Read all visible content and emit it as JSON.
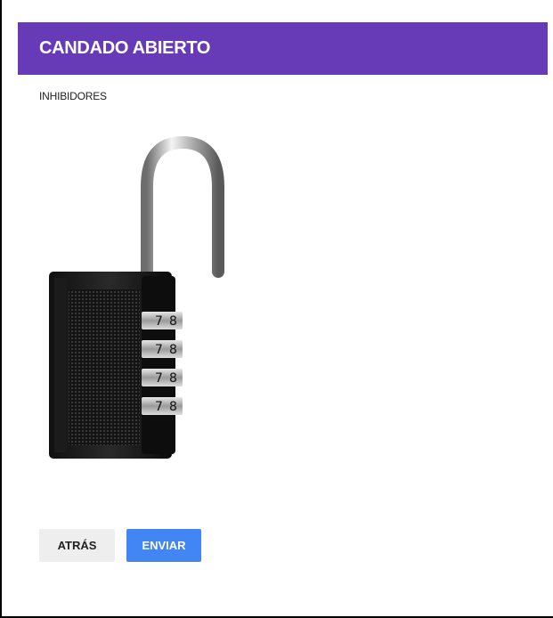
{
  "header": {
    "title": "CANDADO ABIERTO"
  },
  "content": {
    "subtitle": "INHIBIDORES",
    "image_icon": "combination-padlock-open",
    "dial_digits": [
      "7",
      "8"
    ]
  },
  "actions": {
    "back_label": "ATRÁS",
    "send_label": "ENVIAR"
  },
  "colors": {
    "header": "#673ab7",
    "primary_button": "#4285f4",
    "secondary_button": "#eeeeee"
  }
}
